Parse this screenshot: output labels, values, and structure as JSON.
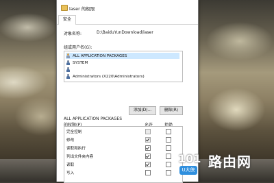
{
  "window": {
    "title": "laser 的权限"
  },
  "tabs": [
    {
      "label": "安全"
    }
  ],
  "object": {
    "label": "对象名称:",
    "value": "D:\\BaiduYunDownload\\laser"
  },
  "groups": {
    "label": "组或用户名(G):",
    "items": [
      {
        "name": "ALL APPLICATION PACKAGES",
        "selected": true,
        "icon": "package-user-icon"
      },
      {
        "name": "SYSTEM",
        "selected": false,
        "icon": "user-group-icon"
      },
      {
        "name": "",
        "selected": false,
        "icon": "user-icon"
      },
      {
        "name": "Administrators (X220\\Administrators)",
        "selected": false,
        "icon": "user-group-icon"
      }
    ]
  },
  "buttons": {
    "add": "添加(D)...",
    "remove": "删除(R)"
  },
  "permissions": {
    "header_line1": "ALL APPLICATION PACKAGES",
    "header_line2": "的权限(P)",
    "allow_label": "允许",
    "deny_label": "拒绝",
    "rows": [
      {
        "name": "完全控制",
        "allow": false,
        "deny": false,
        "allow_gray": true
      },
      {
        "name": "修改",
        "allow": true,
        "deny": false,
        "allow_gray": true
      },
      {
        "name": "读取和执行",
        "allow": true,
        "deny": false,
        "allow_gray": false
      },
      {
        "name": "列出文件夹内容",
        "allow": true,
        "deny": false,
        "allow_gray": false
      },
      {
        "name": "读取",
        "allow": true,
        "deny": false,
        "allow_gray": false
      },
      {
        "name": "写入",
        "allow": false,
        "deny": false,
        "allow_gray": false
      }
    ]
  },
  "logo": {
    "number": "101",
    "text": "路由网",
    "badge": "U大侠"
  }
}
